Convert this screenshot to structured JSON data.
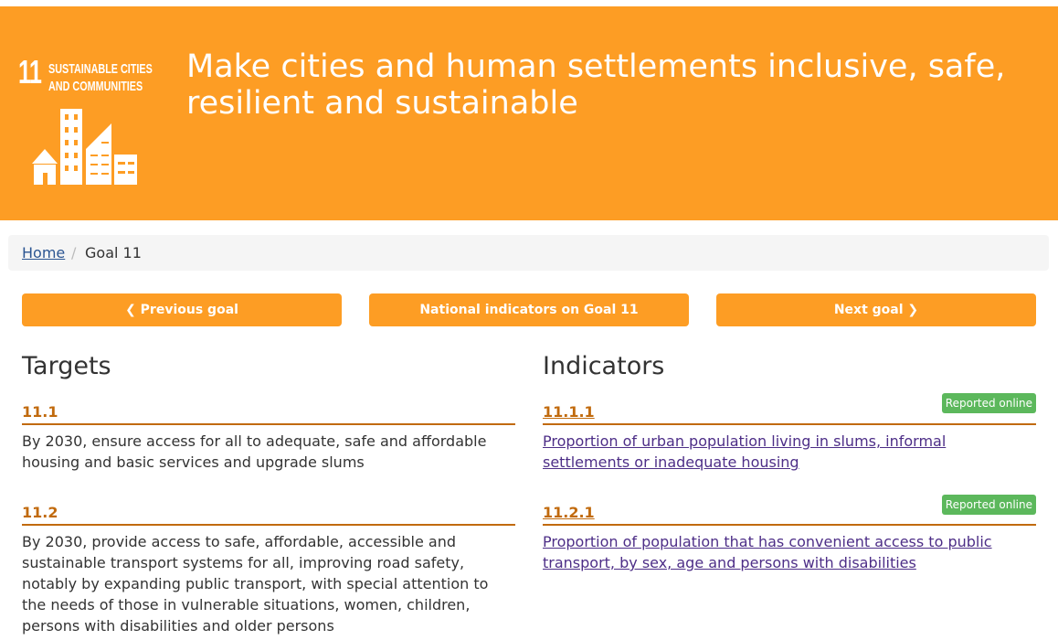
{
  "banner": {
    "logo_number": "11",
    "logo_text_line1": "SUSTAINABLE CITIES",
    "logo_text_line2": "AND COMMUNITIES",
    "title": "Make cities and human settlements inclusive, safe, resilient and sustainable",
    "color": "#fd9d24"
  },
  "breadcrumb": {
    "home": "Home",
    "separator": "/",
    "current": "Goal 11"
  },
  "nav": {
    "previous": "Previous goal",
    "national": "National indicators on Goal 11",
    "next": "Next goal",
    "previous_icon": "chevron-left-icon",
    "next_icon": "chevron-right-icon"
  },
  "targets": {
    "heading": "Targets",
    "items": [
      {
        "code": "11.1",
        "text": "By 2030, ensure access for all to adequate, safe and affordable housing and basic services and upgrade slums"
      },
      {
        "code": "11.2",
        "text": "By 2030, provide access to safe, affordable, accessible and sustainable transport systems for all, improving road safety, notably by expanding public transport, with special attention to the needs of those in vulnerable situations, women, children, persons with disabilities and older persons"
      }
    ]
  },
  "indicators": {
    "heading": "Indicators",
    "items": [
      {
        "code": "11.1.1",
        "badge": "Reported online",
        "text": "Proportion of urban population living in slums, informal settlements or inadequate housing"
      },
      {
        "code": "11.2.1",
        "badge": "Reported online",
        "text": "Proportion of population that has convenient access to public transport, by sex, age and persons with disabilities"
      }
    ]
  }
}
